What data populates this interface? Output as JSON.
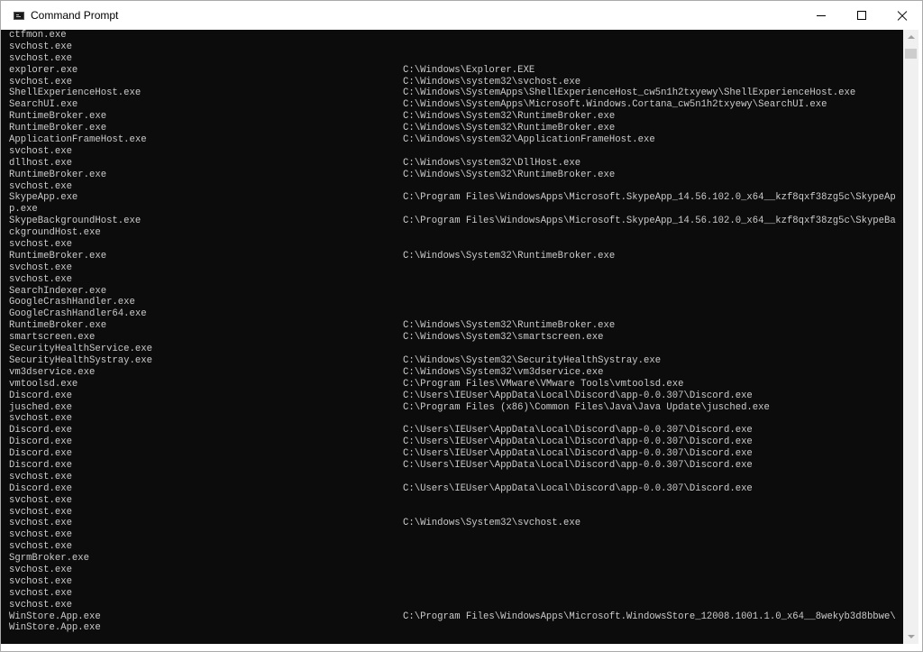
{
  "window": {
    "title": "Command Prompt"
  },
  "icons": {
    "app": "command-prompt-icon",
    "minimize": "minimize-icon",
    "maximize": "maximize-icon",
    "close": "close-icon"
  },
  "colors": {
    "console_background": "#0c0c0c",
    "console_text": "#cccccc",
    "titlebar": "#ffffff"
  },
  "console": {
    "lines": [
      {
        "name": "ctfmon.exe",
        "path": ""
      },
      {
        "name": "svchost.exe",
        "path": ""
      },
      {
        "name": "svchost.exe",
        "path": ""
      },
      {
        "name": "explorer.exe",
        "path": "C:\\Windows\\Explorer.EXE"
      },
      {
        "name": "svchost.exe",
        "path": "C:\\Windows\\system32\\svchost.exe"
      },
      {
        "name": "ShellExperienceHost.exe",
        "path": "C:\\Windows\\SystemApps\\ShellExperienceHost_cw5n1h2txyewy\\ShellExperienceHost.exe"
      },
      {
        "name": "SearchUI.exe",
        "path": "C:\\Windows\\SystemApps\\Microsoft.Windows.Cortana_cw5n1h2txyewy\\SearchUI.exe"
      },
      {
        "name": "RuntimeBroker.exe",
        "path": "C:\\Windows\\System32\\RuntimeBroker.exe"
      },
      {
        "name": "RuntimeBroker.exe",
        "path": "C:\\Windows\\System32\\RuntimeBroker.exe"
      },
      {
        "name": "ApplicationFrameHost.exe",
        "path": "C:\\Windows\\system32\\ApplicationFrameHost.exe"
      },
      {
        "name": "svchost.exe",
        "path": ""
      },
      {
        "name": "dllhost.exe",
        "path": "C:\\Windows\\system32\\DllHost.exe"
      },
      {
        "name": "RuntimeBroker.exe",
        "path": "C:\\Windows\\System32\\RuntimeBroker.exe"
      },
      {
        "name": "svchost.exe",
        "path": ""
      },
      {
        "name": "SkypeApp.exe",
        "path": "C:\\Program Files\\WindowsApps\\Microsoft.SkypeApp_14.56.102.0_x64__kzf8qxf38zg5c\\SkypeAp"
      },
      {
        "name": "p.exe",
        "path": ""
      },
      {
        "name": "SkypeBackgroundHost.exe",
        "path": "C:\\Program Files\\WindowsApps\\Microsoft.SkypeApp_14.56.102.0_x64__kzf8qxf38zg5c\\SkypeBa"
      },
      {
        "name": "ckgroundHost.exe",
        "path": ""
      },
      {
        "name": "svchost.exe",
        "path": ""
      },
      {
        "name": "RuntimeBroker.exe",
        "path": "C:\\Windows\\System32\\RuntimeBroker.exe"
      },
      {
        "name": "svchost.exe",
        "path": ""
      },
      {
        "name": "svchost.exe",
        "path": ""
      },
      {
        "name": "SearchIndexer.exe",
        "path": ""
      },
      {
        "name": "GoogleCrashHandler.exe",
        "path": ""
      },
      {
        "name": "GoogleCrashHandler64.exe",
        "path": ""
      },
      {
        "name": "RuntimeBroker.exe",
        "path": "C:\\Windows\\System32\\RuntimeBroker.exe"
      },
      {
        "name": "smartscreen.exe",
        "path": "C:\\Windows\\System32\\smartscreen.exe"
      },
      {
        "name": "SecurityHealthService.exe",
        "path": ""
      },
      {
        "name": "SecurityHealthSystray.exe",
        "path": "C:\\Windows\\System32\\SecurityHealthSystray.exe"
      },
      {
        "name": "vm3dservice.exe",
        "path": "C:\\Windows\\System32\\vm3dservice.exe"
      },
      {
        "name": "vmtoolsd.exe",
        "path": "C:\\Program Files\\VMware\\VMware Tools\\vmtoolsd.exe"
      },
      {
        "name": "Discord.exe",
        "path": "C:\\Users\\IEUser\\AppData\\Local\\Discord\\app-0.0.307\\Discord.exe"
      },
      {
        "name": "jusched.exe",
        "path": "C:\\Program Files (x86)\\Common Files\\Java\\Java Update\\jusched.exe"
      },
      {
        "name": "svchost.exe",
        "path": ""
      },
      {
        "name": "Discord.exe",
        "path": "C:\\Users\\IEUser\\AppData\\Local\\Discord\\app-0.0.307\\Discord.exe"
      },
      {
        "name": "Discord.exe",
        "path": "C:\\Users\\IEUser\\AppData\\Local\\Discord\\app-0.0.307\\Discord.exe"
      },
      {
        "name": "Discord.exe",
        "path": "C:\\Users\\IEUser\\AppData\\Local\\Discord\\app-0.0.307\\Discord.exe"
      },
      {
        "name": "Discord.exe",
        "path": "C:\\Users\\IEUser\\AppData\\Local\\Discord\\app-0.0.307\\Discord.exe"
      },
      {
        "name": "svchost.exe",
        "path": ""
      },
      {
        "name": "Discord.exe",
        "path": "C:\\Users\\IEUser\\AppData\\Local\\Discord\\app-0.0.307\\Discord.exe"
      },
      {
        "name": "svchost.exe",
        "path": ""
      },
      {
        "name": "svchost.exe",
        "path": ""
      },
      {
        "name": "svchost.exe",
        "path": "C:\\Windows\\System32\\svchost.exe"
      },
      {
        "name": "svchost.exe",
        "path": ""
      },
      {
        "name": "svchost.exe",
        "path": ""
      },
      {
        "name": "SgrmBroker.exe",
        "path": ""
      },
      {
        "name": "svchost.exe",
        "path": ""
      },
      {
        "name": "svchost.exe",
        "path": ""
      },
      {
        "name": "svchost.exe",
        "path": ""
      },
      {
        "name": "svchost.exe",
        "path": ""
      },
      {
        "name": "WinStore.App.exe",
        "path": "C:\\Program Files\\WindowsApps\\Microsoft.WindowsStore_12008.1001.1.0_x64__8wekyb3d8bbwe\\"
      },
      {
        "name": "WinStore.App.exe",
        "path": ""
      }
    ]
  }
}
